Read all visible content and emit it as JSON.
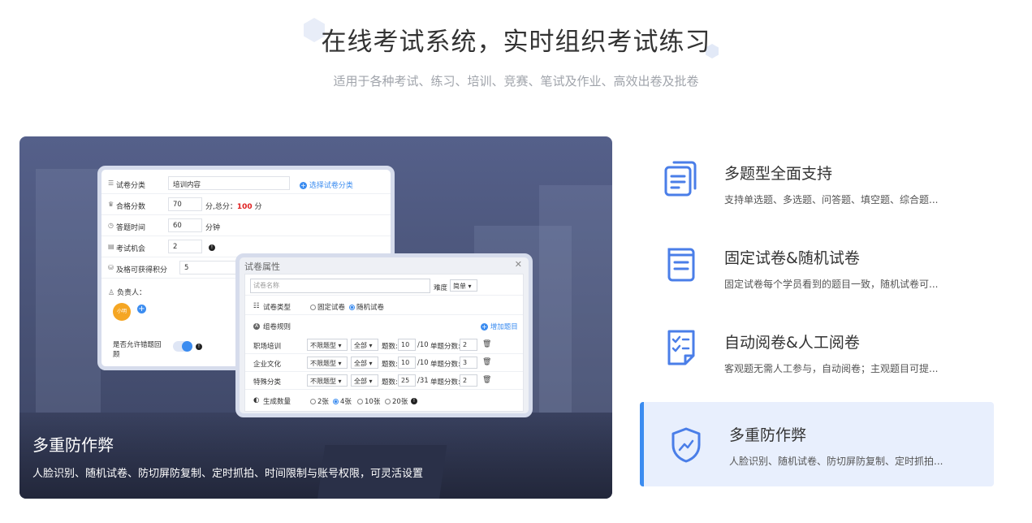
{
  "header": {
    "title": "在线考试系统，实时组织考试练习",
    "subtitle": "适用于各种考试、练习、培训、竞赛、笔试及作业、高效出卷及批卷"
  },
  "showcase": {
    "title": "多重防作弊",
    "desc": "人脸识别、随机试卷、防切屏防复制、定时抓拍、时间限制与账号权限，可灵活设置"
  },
  "form": {
    "category_label": "试卷分类",
    "category_value": "培训内容",
    "category_link": "选择试卷分类",
    "pass_label": "合格分数",
    "pass_value": "70",
    "pass_total_prefix": "分,总分：",
    "pass_total": "100",
    "pass_total_suffix": "分",
    "time_label": "答题时间",
    "time_value": "60",
    "time_unit": "分钟",
    "chances_label": "考试机会",
    "chances_value": "2",
    "points_label": "及格可获得积分",
    "points_value": "5",
    "owner_label": "负责人：",
    "owner_avatar": "小明",
    "allow_label_1": "是否允许错题回",
    "allow_label_2": "顾"
  },
  "modal": {
    "title": "试卷属性",
    "name_placeholder": "试卷名称",
    "difficulty_label": "难度",
    "difficulty_value": "简单",
    "type_label": "试卷类型",
    "type_options": [
      "固定试卷",
      "随机试卷"
    ],
    "rule_label": "组卷规则",
    "add_link": "增加题目",
    "rules": [
      {
        "name": "职场培训",
        "qtype": "不限题型",
        "scope": "全部",
        "count_label": "题数:",
        "count": "10",
        "total": "/10",
        "score_label": "单题分数:",
        "score": "2"
      },
      {
        "name": "企业文化",
        "qtype": "不限题型",
        "scope": "全部",
        "count_label": "题数:",
        "count": "10",
        "total": "/10",
        "score_label": "单题分数:",
        "score": "3"
      },
      {
        "name": "特殊分类",
        "qtype": "不限题型",
        "scope": "全部",
        "count_label": "题数:",
        "count": "25",
        "total": "/31",
        "score_label": "单题分数:",
        "score": "2"
      }
    ],
    "gen_label": "生成数量",
    "gen_options": [
      "2张",
      "4张",
      "10张",
      "20张"
    ]
  },
  "features": [
    {
      "title": "多题型全面支持",
      "desc": "支持单选题、多选题、问答题、填空题、综合题...",
      "icon": "document-stack-icon"
    },
    {
      "title": "固定试卷&随机试卷",
      "desc": "固定试卷每个学员看到的题目一致，随机试卷可...",
      "icon": "document-icon"
    },
    {
      "title": "自动阅卷&人工阅卷",
      "desc": "客观题无需人工参与，自动阅卷；主观题目可提...",
      "icon": "checklist-icon"
    },
    {
      "title": "多重防作弊",
      "desc": "人脸识别、随机试卷、防切屏防复制、定时抓拍...",
      "icon": "shield-icon"
    }
  ],
  "colors": {
    "accent": "#3b8cf0",
    "active_bg": "#e8effd",
    "icon_blue": "#4a7ee8"
  }
}
